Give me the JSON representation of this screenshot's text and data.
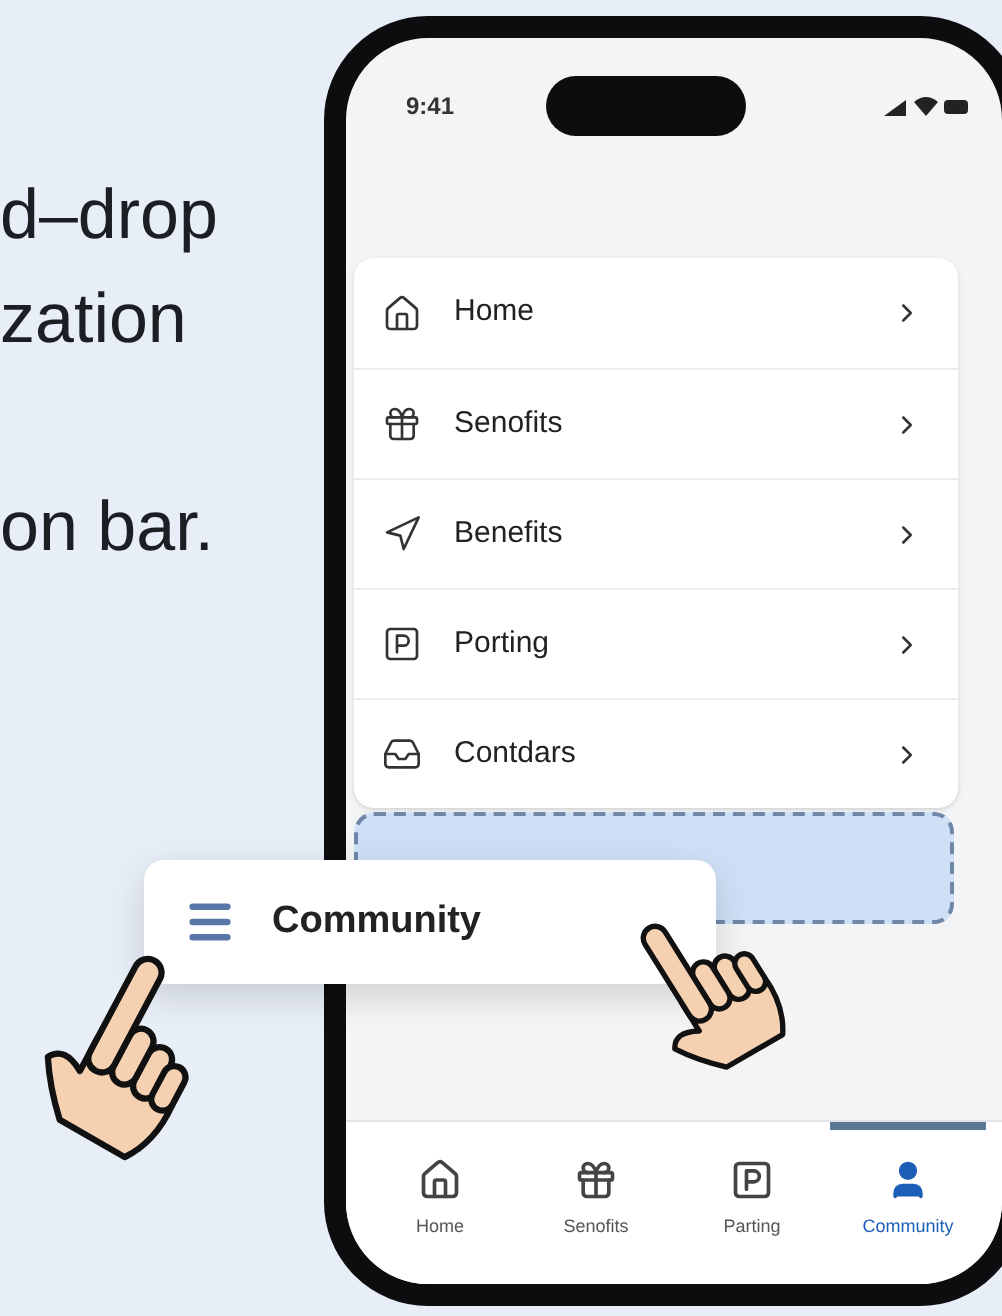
{
  "caption_lines": [
    "d–drop",
    "zation",
    "on bar."
  ],
  "status_bar": {
    "time": "9:41"
  },
  "menu_items": [
    {
      "label": "Home",
      "kind": "home"
    },
    {
      "label": "Senofits",
      "kind": "gift"
    },
    {
      "label": "Benefits",
      "kind": "navigation"
    },
    {
      "label": "Porting",
      "kind": "parking"
    },
    {
      "label": "Contdars",
      "kind": "inbox"
    }
  ],
  "drop_placeholder": {
    "visible": true
  },
  "drag_card": {
    "label": "Community"
  },
  "tab_bar": [
    {
      "label": "Home",
      "kind": "home",
      "selected": false
    },
    {
      "label": "Senofits",
      "kind": "gift",
      "selected": false
    },
    {
      "label": "Parting",
      "kind": "parking",
      "selected": false
    },
    {
      "label": "Community",
      "kind": "user",
      "selected": true
    }
  ]
}
